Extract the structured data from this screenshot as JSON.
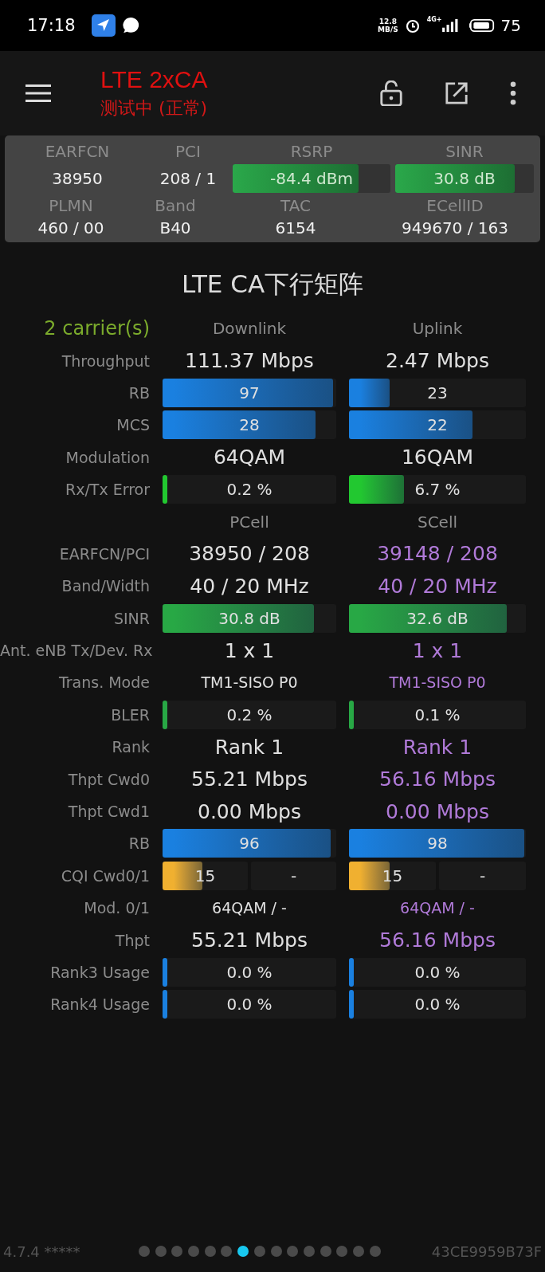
{
  "status_bar": {
    "time": "17:18",
    "speed_value": "12.8",
    "speed_unit": "MB/S",
    "network": "4G+",
    "battery": "75"
  },
  "app_bar": {
    "title": "LTE 2xCA",
    "subtitle": "测试中 (正常)"
  },
  "summary": {
    "top": [
      {
        "label": "EARFCN",
        "value": "38950"
      },
      {
        "label": "PCI",
        "value": "208 / 1"
      },
      {
        "label": "RSRP",
        "value": "-84.4 dBm",
        "level": 0.8
      },
      {
        "label": "SINR",
        "value": "30.8 dB",
        "level": 0.86
      }
    ],
    "bottom": [
      {
        "label": "PLMN",
        "value": "460 / 00"
      },
      {
        "label": "Band",
        "value": "B40"
      },
      {
        "label": "TAC",
        "value": "6154"
      },
      {
        "label": "ECellID",
        "value": "949670 / 163"
      }
    ]
  },
  "heading": "LTE CA下行矩阵",
  "sections": [
    {
      "label": "2 carrier(s)",
      "columns": [
        {
          "title": "Downlink",
          "color": "#e0e0e0"
        },
        {
          "title": "Uplink",
          "color": "#e0e0e0"
        }
      ],
      "rows": [
        {
          "label": "Throughput",
          "kind": "value",
          "cells": [
            {
              "text": "111.37 Mbps"
            },
            {
              "text": "2.47 Mbps"
            }
          ]
        },
        {
          "label": "RB",
          "kind": "bar",
          "color": "#1a80e0",
          "cells": [
            {
              "text": "97",
              "level": 0.98
            },
            {
              "text": "23",
              "level": 0.23
            }
          ]
        },
        {
          "label": "MCS",
          "kind": "bar",
          "color": "#1a80e0",
          "cells": [
            {
              "text": "28",
              "level": 0.88
            },
            {
              "text": "22",
              "level": 0.7
            }
          ]
        },
        {
          "label": "Modulation",
          "kind": "value",
          "cells": [
            {
              "text": "64QAM"
            },
            {
              "text": "16QAM"
            }
          ]
        },
        {
          "label": "Rx/Tx Error",
          "kind": "bar",
          "color": "#22c830",
          "cells": [
            {
              "text": "0.2 %",
              "level": 0.02
            },
            {
              "text": "6.7 %",
              "level": 0.31
            }
          ]
        }
      ]
    },
    {
      "columns": [
        {
          "title": "PCell",
          "color": "#e0e0e0"
        },
        {
          "title": "SCell",
          "color": "#b07ad8"
        }
      ],
      "rows": [
        {
          "label": "EARFCN/PCI",
          "kind": "value",
          "cells": [
            {
              "text": "38950 / 208"
            },
            {
              "text": "39148 / 208"
            }
          ]
        },
        {
          "label": "Band/Width",
          "kind": "value",
          "cells": [
            {
              "text": "40 / 20 MHz"
            },
            {
              "text": "40 / 20 MHz"
            }
          ]
        },
        {
          "label": "SINR",
          "kind": "bar",
          "color": "#28a845",
          "cells": [
            {
              "text": "30.8 dB",
              "level": 0.87
            },
            {
              "text": "32.6 dB",
              "level": 0.89
            }
          ]
        },
        {
          "label": "Ant. eNB Tx/Dev. Rx",
          "kind": "value",
          "cells": [
            {
              "text": "1 x 1"
            },
            {
              "text": "1 x 1"
            }
          ]
        },
        {
          "label": "Trans. Mode",
          "kind": "small",
          "cells": [
            {
              "text": "TM1-SISO P0"
            },
            {
              "text": "TM1-SISO P0"
            }
          ]
        },
        {
          "label": "BLER",
          "kind": "bar",
          "color": "#28a845",
          "cells": [
            {
              "text": "0.2 %",
              "level": 0.02
            },
            {
              "text": "0.1 %",
              "level": 0.01
            }
          ]
        },
        {
          "label": "Rank",
          "kind": "value",
          "cells": [
            {
              "text": "Rank 1"
            },
            {
              "text": "Rank 1"
            }
          ]
        },
        {
          "label": "Thpt Cwd0",
          "kind": "value",
          "cells": [
            {
              "text": "55.21 Mbps"
            },
            {
              "text": "56.16 Mbps"
            }
          ]
        },
        {
          "label": "Thpt Cwd1",
          "kind": "value",
          "cells": [
            {
              "text": "0.00 Mbps"
            },
            {
              "text": "0.00 Mbps"
            }
          ]
        },
        {
          "label": "RB",
          "kind": "bar",
          "color": "#1a80e0",
          "cells": [
            {
              "text": "96",
              "level": 0.97
            },
            {
              "text": "98",
              "level": 0.99
            }
          ]
        },
        {
          "label": "CQI Cwd0/1",
          "kind": "split-bar",
          "color": "#f0b030",
          "cells": [
            {
              "parts": [
                {
                  "text": "15",
                  "level": 0.47
                },
                {
                  "text": "-"
                }
              ]
            },
            {
              "parts": [
                {
                  "text": "15",
                  "level": 0.47
                },
                {
                  "text": "-"
                }
              ]
            }
          ]
        },
        {
          "label": "Mod. 0/1",
          "kind": "small",
          "cells": [
            {
              "text": "64QAM / -"
            },
            {
              "text": "64QAM / -"
            }
          ]
        },
        {
          "label": "Thpt",
          "kind": "value",
          "cells": [
            {
              "text": "55.21 Mbps"
            },
            {
              "text": "56.16 Mbps"
            }
          ]
        },
        {
          "label": "Rank3 Usage",
          "kind": "bar",
          "color": "#1a80e0",
          "cells": [
            {
              "text": "0.0 %",
              "level": 0.01
            },
            {
              "text": "0.0 %",
              "level": 0.01
            }
          ]
        },
        {
          "label": "Rank4 Usage",
          "kind": "bar",
          "color": "#1a80e0",
          "cells": [
            {
              "text": "0.0 %",
              "level": 0.01
            },
            {
              "text": "0.0 %",
              "level": 0.01
            }
          ]
        }
      ]
    }
  ],
  "footer": {
    "version": "4.7.4 *****",
    "device_id": "43CE9959B73F",
    "pages": [
      {
        "selected": false
      },
      {
        "selected": false
      },
      {
        "selected": false
      },
      {
        "selected": false
      },
      {
        "selected": false
      },
      {
        "selected": false
      },
      {
        "selected": true
      },
      {
        "selected": false
      },
      {
        "selected": false
      },
      {
        "selected": false
      },
      {
        "selected": false
      },
      {
        "selected": false
      },
      {
        "selected": false
      },
      {
        "selected": false
      },
      {
        "selected": false
      }
    ]
  }
}
